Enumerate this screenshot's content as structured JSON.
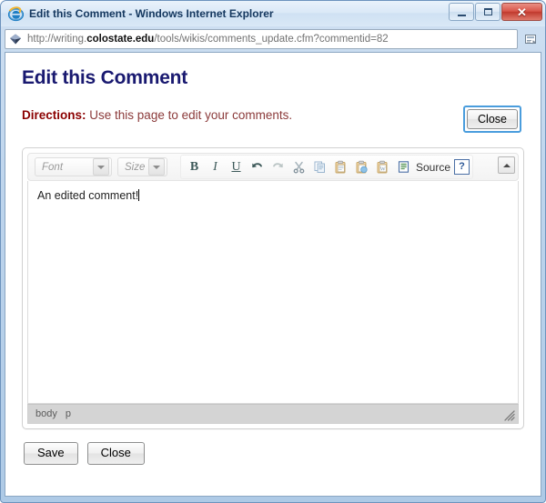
{
  "window": {
    "title": "Edit this Comment - Windows Internet Explorer",
    "browser_icon": "internet-explorer-icon",
    "controls": {
      "minimize": "minimize-button",
      "maximize": "maximize-button",
      "close": "close-window-button",
      "close_glyph": "✕"
    }
  },
  "address_bar": {
    "favicon": "site-favicon-diamond",
    "url_prefix": "http://writing.",
    "url_domain": "colostate.edu",
    "url_suffix": "/tools/wikis/comments_update.cfm?commentid=82",
    "url_full": "http://writing.colostate.edu/tools/wikis/comments_update.cfm?commentid=82",
    "right_icon": "compatibility-view-icon"
  },
  "page": {
    "title": "Edit this Comment",
    "directions_label": "Directions:",
    "directions_text": "Use this page to edit your comments.",
    "close_top_label": "Close"
  },
  "editor": {
    "toolbar": {
      "font_placeholder": "Font",
      "size_placeholder": "Size",
      "buttons": [
        {
          "name": "bold-button",
          "glyph": "B",
          "enabled": true
        },
        {
          "name": "italic-button",
          "glyph": "I",
          "enabled": true
        },
        {
          "name": "underline-button",
          "glyph": "U",
          "enabled": true
        },
        {
          "name": "undo-button",
          "glyph": "↩",
          "enabled": true
        },
        {
          "name": "redo-button",
          "glyph": "↪",
          "enabled": false
        },
        {
          "name": "cut-button",
          "glyph": "✂",
          "enabled": false
        },
        {
          "name": "copy-button",
          "glyph": "copy",
          "enabled": false
        },
        {
          "name": "paste-button",
          "glyph": "paste",
          "enabled": false
        },
        {
          "name": "paste-as-text-button",
          "glyph": "paste-t",
          "enabled": false
        },
        {
          "name": "paste-from-word-button",
          "glyph": "paste-w",
          "enabled": false
        }
      ],
      "source_label": "Source",
      "source_icon": "source-code-icon",
      "help_label": "?",
      "collapse_icon": "collapse-toolbar-icon"
    },
    "content": "An edited comment!",
    "status": {
      "path": [
        "body",
        "p"
      ],
      "resize_grip": "resize-grip-icon"
    }
  },
  "footer": {
    "save_label": "Save",
    "close_label": "Close"
  },
  "colors": {
    "page_title": "#191970",
    "directions_label": "#8b0000",
    "directions_text": "#8b3a3a",
    "focus_ring": "#4a9ddd",
    "window_close": "#c03a2e",
    "toolbar_icon": "#3e5a5a"
  }
}
